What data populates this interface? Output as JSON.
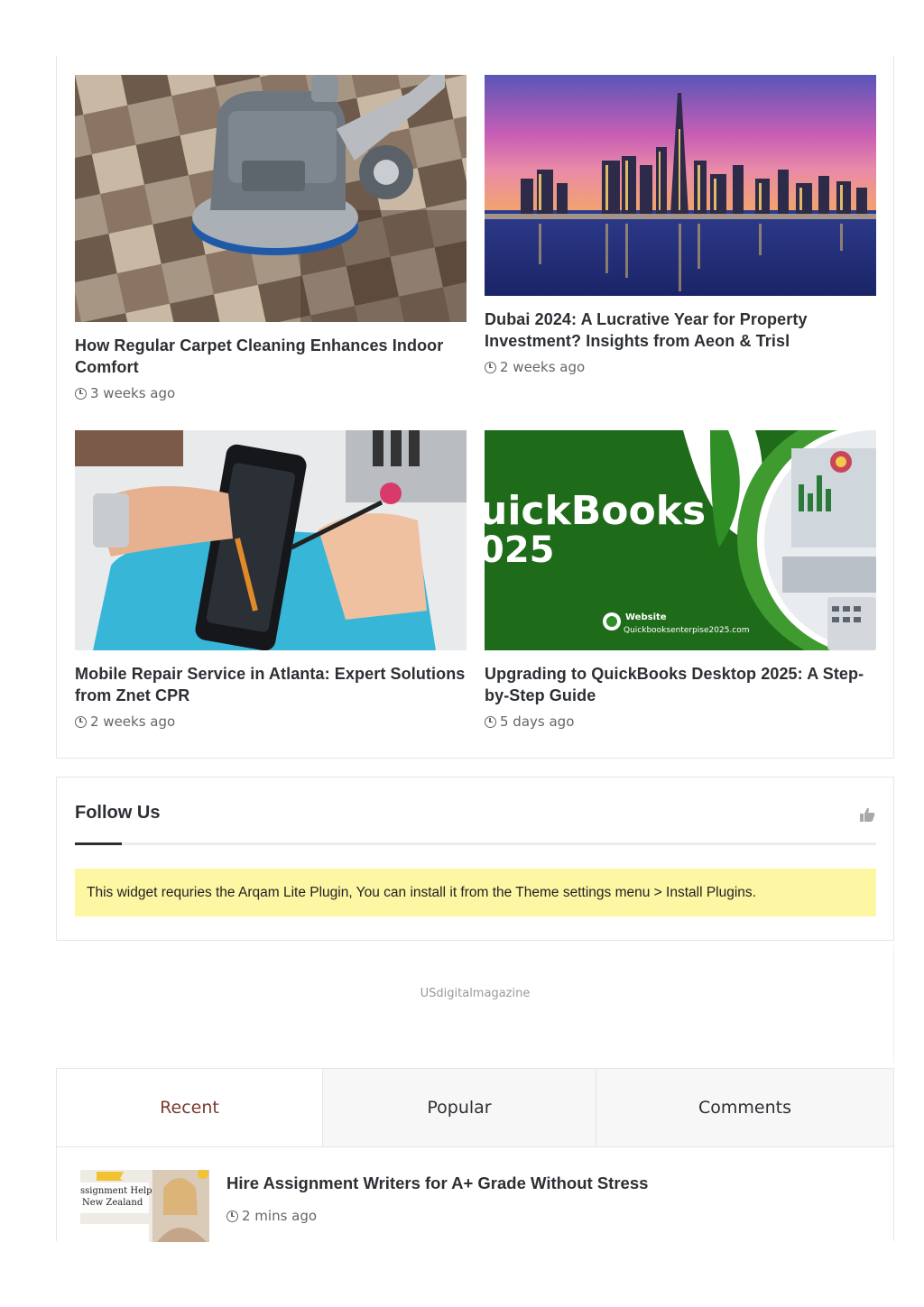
{
  "posts": [
    {
      "title": "How Regular Carpet Cleaning Enhances Indoor Comfort",
      "time": "3 weeks ago",
      "image": "carpet-cleaning-machine"
    },
    {
      "title": "Dubai 2024: A Lucrative Year for Property Investment? Insights from Aeon & Trisl",
      "time": "2 weeks ago",
      "image": "dubai-skyline"
    },
    {
      "title": "Mobile Repair Service in Atlanta: Expert Solutions from Znet CPR",
      "time": "2 weeks ago",
      "image": "phone-repair"
    },
    {
      "title": "Upgrading to QuickBooks Desktop 2025: A Step-by-Step Guide",
      "time": "5 days ago",
      "image": "quickbooks-banner"
    }
  ],
  "quickbooks_banner": {
    "line1": "uickBooks",
    "line2": "025",
    "website_label": "Website",
    "website_url": "Quickbooksenterpise2025.com"
  },
  "follow": {
    "title": "Follow Us",
    "icon": "thumbs-up-icon",
    "notice": "This widget requries the Arqam Lite Plugin, You can install it from the Theme settings menu > Install Plugins."
  },
  "ad": {
    "text": "USdigitalmagazine"
  },
  "tabs": {
    "items": [
      "Recent",
      "Popular",
      "Comments"
    ],
    "active": "Recent"
  },
  "recent": [
    {
      "title": "Hire Assignment Writers for A+ Grade Without Stress",
      "time": "2 mins ago",
      "thumb_text_1": "ssignment Help",
      "thumb_text_2": "New Zealand"
    }
  ],
  "colors": {
    "accent": "#7a3b2e",
    "notice_bg": "#fdf6a3",
    "quickbooks_green": "#1e6b1a"
  }
}
